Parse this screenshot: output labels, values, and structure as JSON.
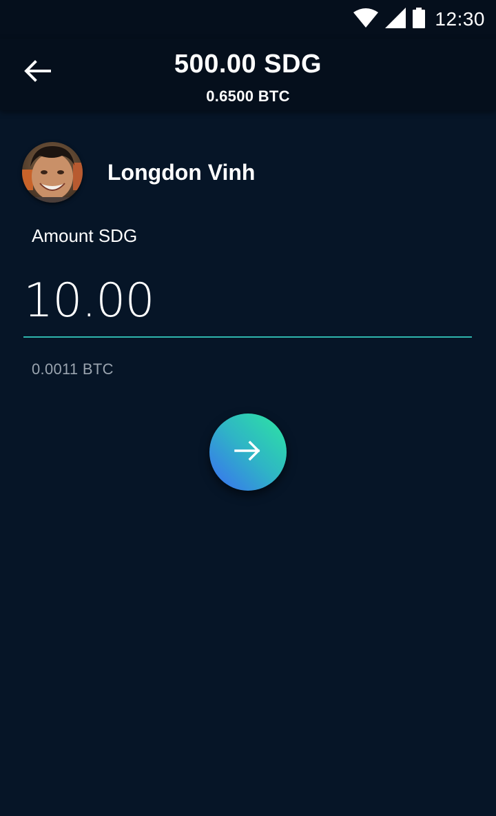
{
  "status_bar": {
    "time": "12:30",
    "icons": [
      "wifi-icon",
      "signal-icon",
      "battery-icon"
    ]
  },
  "header": {
    "back_icon": "arrow-back-icon",
    "balance": "500.00 SDG",
    "balance_btc": "0.6500 BTC"
  },
  "contact": {
    "name": "Longdon Vinh",
    "avatar": "avatar-photo"
  },
  "amount": {
    "label": "Amount SDG",
    "value": "10.00",
    "btc_equivalent": "0.0011 BTC"
  },
  "next_button": {
    "icon": "arrow-forward-icon"
  },
  "colors": {
    "background": "#061527",
    "app_bar": "#050f1c",
    "accent_underline": "#2fb7ae",
    "secondary_text": "#9aa4af",
    "gradient_start": "#3a6cf4",
    "gradient_end": "#2de7a0"
  }
}
